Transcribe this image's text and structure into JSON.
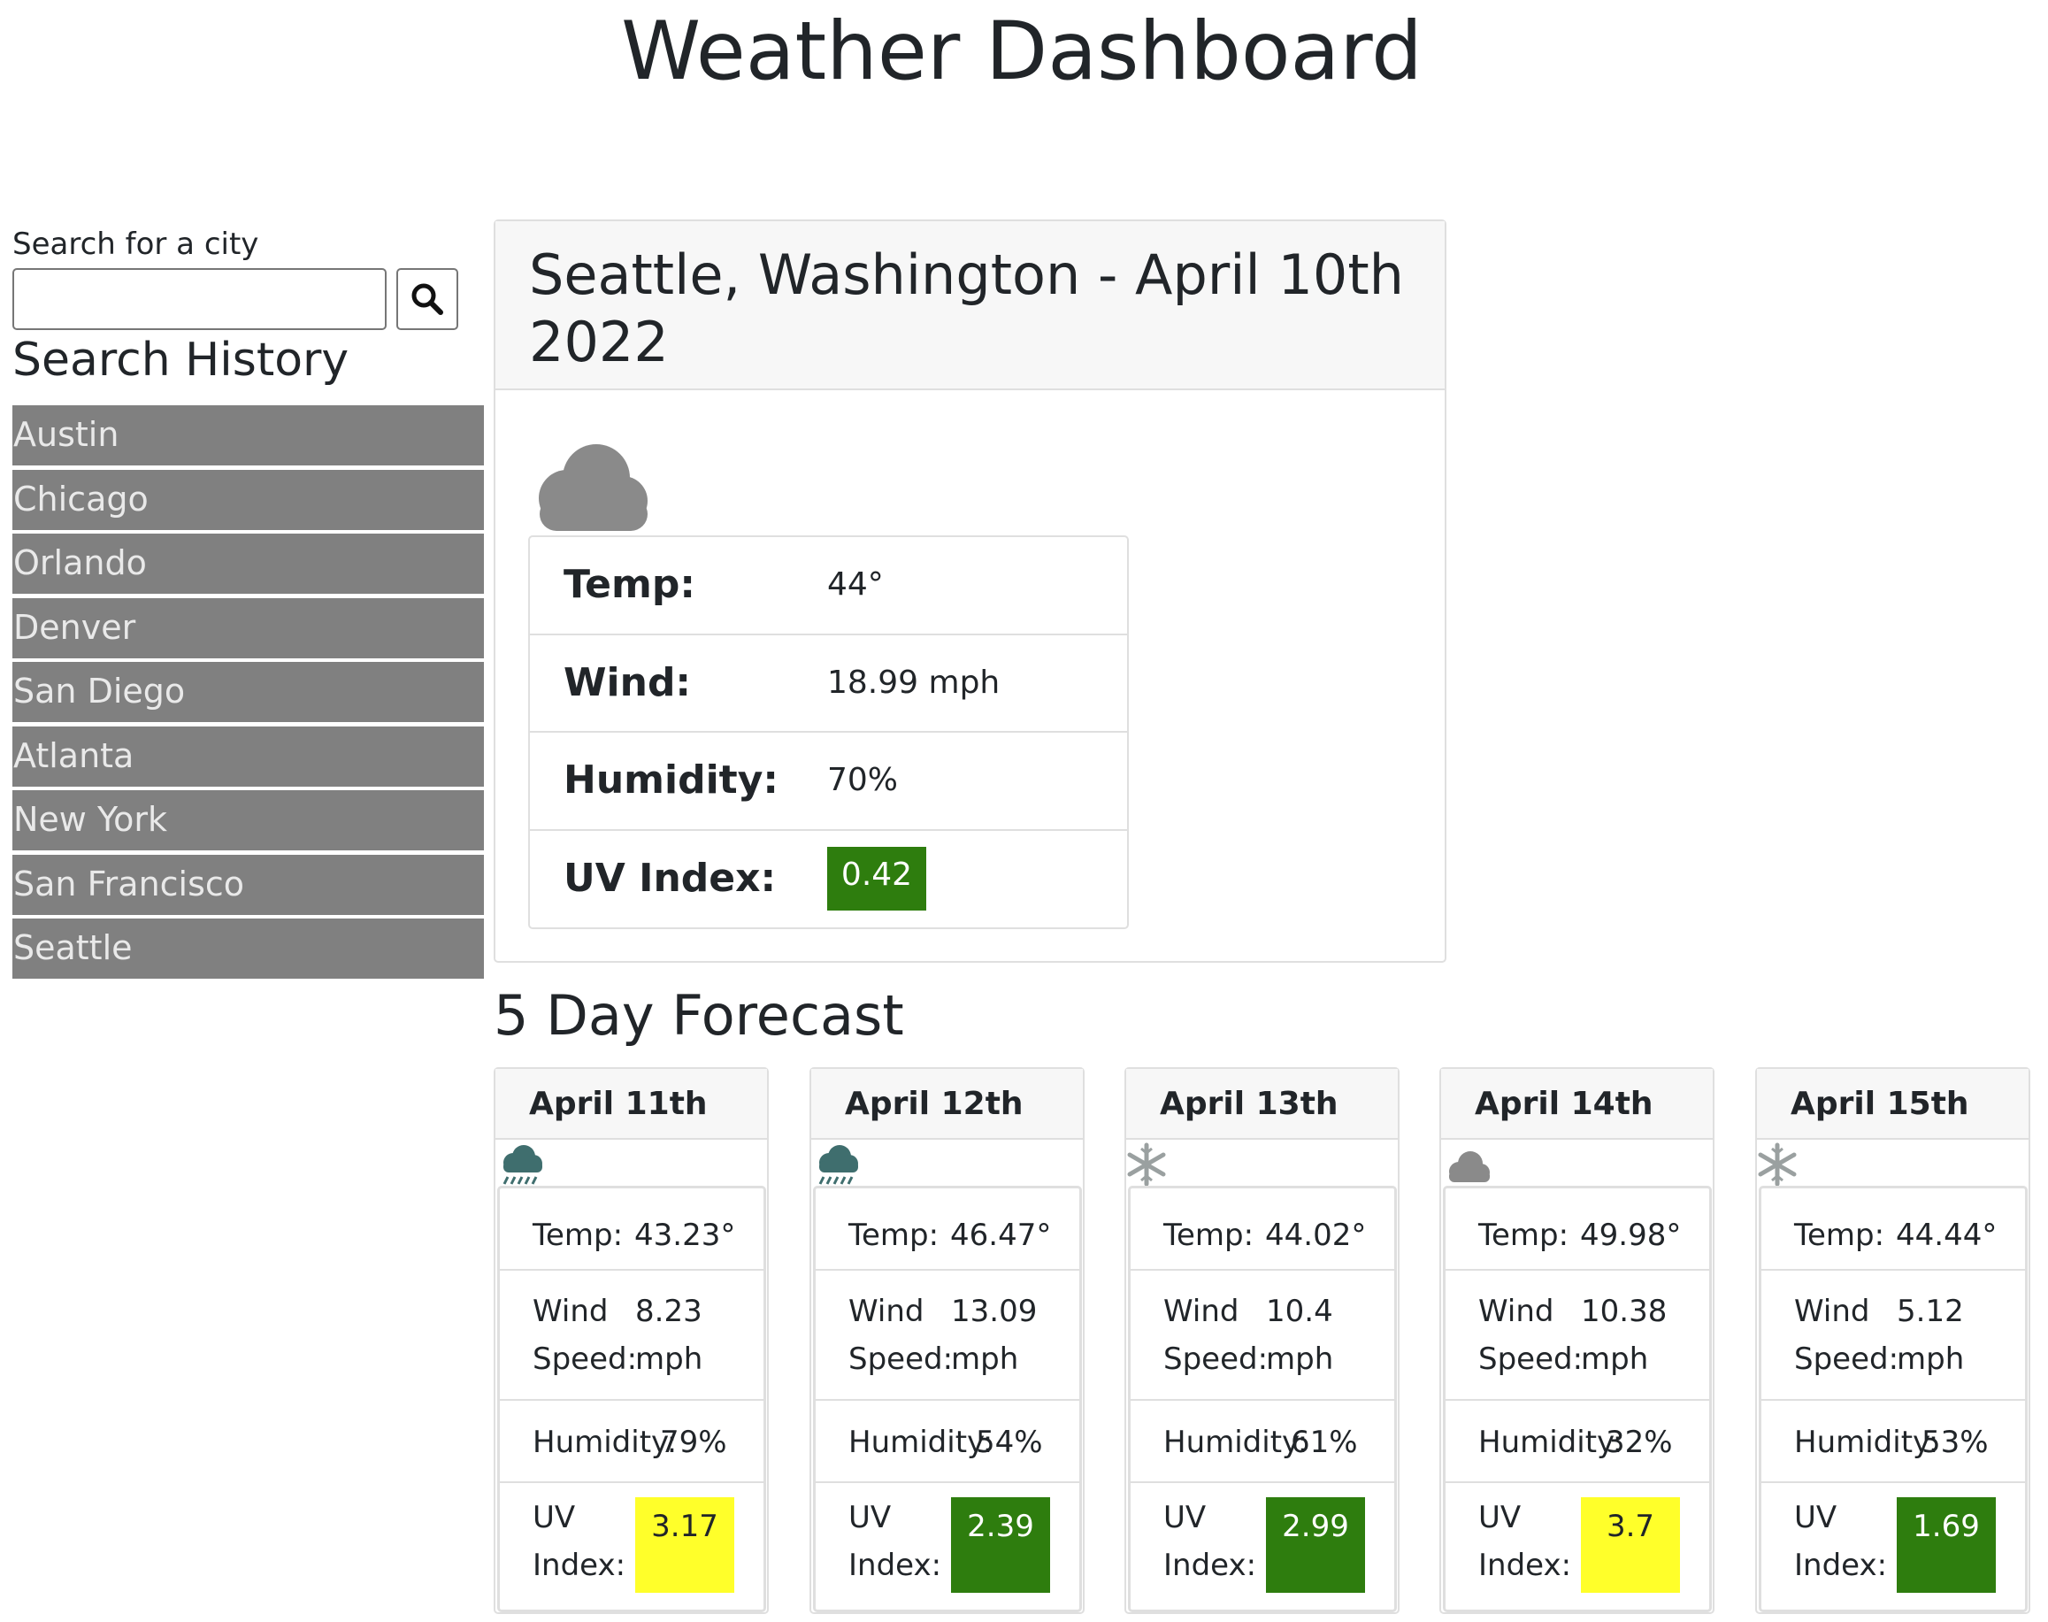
{
  "page": {
    "title": "Weather Dashboard"
  },
  "sidebar": {
    "search_label": "Search for a city",
    "search_value": "",
    "history_title": "Search History",
    "history": [
      "Austin",
      "Chicago",
      "Orlando",
      "Denver",
      "San Diego",
      "Atlanta",
      "New York",
      "San Francisco",
      "Seattle"
    ]
  },
  "current": {
    "heading": "Seattle, Washington - April 10th 2022",
    "icon": "cloud-icon",
    "temp_label": "Temp:",
    "temp": "44°",
    "wind_label": "Wind:",
    "wind": "18.99 mph",
    "humidity_label": "Humidity:",
    "humidity": "70%",
    "uv_label": "UV Index:",
    "uv": "0.42",
    "uv_color": "#2e7d0e"
  },
  "forecast": {
    "title": "5 Day Forecast",
    "temp_label": "Temp:",
    "wind_label": "Wind Speed:",
    "humidity_label": "Humidity:",
    "uv_label": "UV Index:",
    "days": [
      {
        "date": "April 11th",
        "icon": "rain-cloud-icon",
        "temp": "43.23°",
        "wind": "8.23 mph",
        "humidity": "79%",
        "uv": "3.17",
        "uv_color": "#ffff2a",
        "uv_text_color": "#212529"
      },
      {
        "date": "April 12th",
        "icon": "rain-cloud-icon",
        "temp": "46.47°",
        "wind": "13.09 mph",
        "humidity": "54%",
        "uv": "2.39",
        "uv_color": "#2e7d0e",
        "uv_text_color": "#ffffff"
      },
      {
        "date": "April 13th",
        "icon": "snowflake-icon",
        "temp": "44.02°",
        "wind": "10.4 mph",
        "humidity": "61%",
        "uv": "2.99",
        "uv_color": "#2e7d0e",
        "uv_text_color": "#ffffff"
      },
      {
        "date": "April 14th",
        "icon": "cloud-icon",
        "temp": "49.98°",
        "wind": "10.38 mph",
        "humidity": "32%",
        "uv": "3.7",
        "uv_color": "#ffff2a",
        "uv_text_color": "#212529"
      },
      {
        "date": "April 15th",
        "icon": "snowflake-icon",
        "temp": "44.44°",
        "wind": "5.12 mph",
        "humidity": "53%",
        "uv": "1.69",
        "uv_color": "#2e7d0e",
        "uv_text_color": "#ffffff"
      }
    ]
  }
}
